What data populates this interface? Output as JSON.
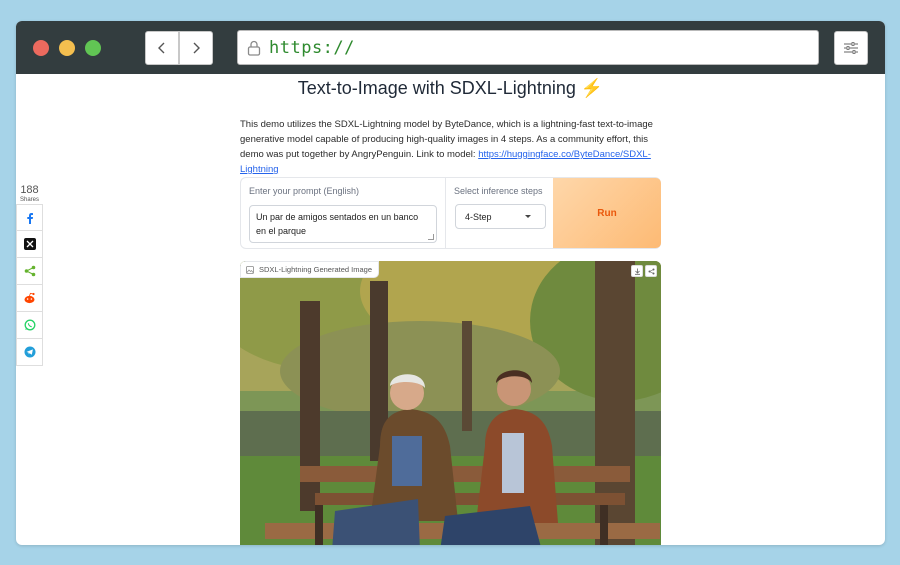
{
  "browser": {
    "url": "https://",
    "colors": {
      "titlebar": "#333d3f",
      "url_text": "#2e8a2e",
      "close": "#ec6a5e",
      "minimize": "#f4bf4f",
      "maximize": "#61c554"
    }
  },
  "share": {
    "count": "188",
    "count_label": "Shares",
    "buttons": [
      "facebook-icon",
      "x-icon",
      "share-icon",
      "reddit-icon",
      "whatsapp-icon",
      "telegram-icon"
    ]
  },
  "page": {
    "title": "Text-to-Image with SDXL-Lightning ⚡",
    "description_prefix": "This demo utilizes the SDXL-Lightning model by ByteDance, which is a lightning-fast text-to-image generative model capable of producing high-quality images in 4 steps. As a community effort, this demo was put together by AngryPenguin. Link to model: ",
    "model_link": "https://huggingface.co/ByteDance/SDXL-Lightning"
  },
  "form": {
    "prompt_label": "Enter your prompt (English)",
    "prompt_value": "Un par de amigos sentados en un banco en el parque",
    "steps_label": "Select inference steps",
    "steps_value": "4-Step",
    "run_label": "Run",
    "run_color": "#ea580c"
  },
  "output": {
    "label": "SDXL-Lightning Generated Image",
    "tools": [
      "download-icon",
      "share-icon"
    ]
  }
}
